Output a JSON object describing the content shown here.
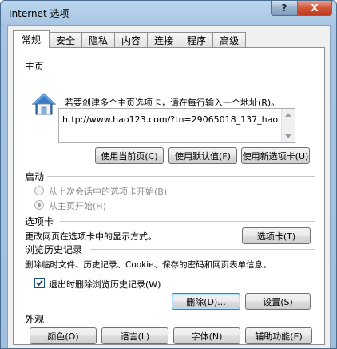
{
  "window": {
    "title": "Internet 选项",
    "help_glyph": "?",
    "close_glyph": "X"
  },
  "tabs": [
    {
      "label": "常规",
      "active": true
    },
    {
      "label": "安全"
    },
    {
      "label": "隐私"
    },
    {
      "label": "内容"
    },
    {
      "label": "连接"
    },
    {
      "label": "程序"
    },
    {
      "label": "高级"
    }
  ],
  "home": {
    "section_title": "主页",
    "instruction": "若要创建多个主页选项卡，请在每行输入一个地址(R)。",
    "url_value": "http://www.hao123.com/?tn=29065018_137_hao",
    "buttons": {
      "use_current": "使用当前页(C)",
      "use_default": "使用默认值(F)",
      "use_new_tab": "使用新选项卡(U)"
    }
  },
  "startup": {
    "section_title": "启动",
    "option_last_session": "从上次会话中的选项卡开始(B)",
    "option_home_page": "从主页开始(H)"
  },
  "tabs_section": {
    "section_title": "选项卡",
    "description": "更改网页在选项卡中的显示方式。",
    "button": "选项卡(T)"
  },
  "history": {
    "section_title": "浏览历史记录",
    "description": "删除临时文件、历史记录、Cookie、保存的密码和网页表单信息。",
    "checkbox_label": "退出时删除浏览历史记录(W)",
    "checkbox_checked": true,
    "delete_button": "删除(D)...",
    "settings_button": "设置(S)"
  },
  "appearance": {
    "section_title": "外观",
    "colors_button": "颜色(O)",
    "languages_button": "语言(L)",
    "fonts_button": "字体(N)",
    "accessibility_button": "辅助功能(E)"
  }
}
